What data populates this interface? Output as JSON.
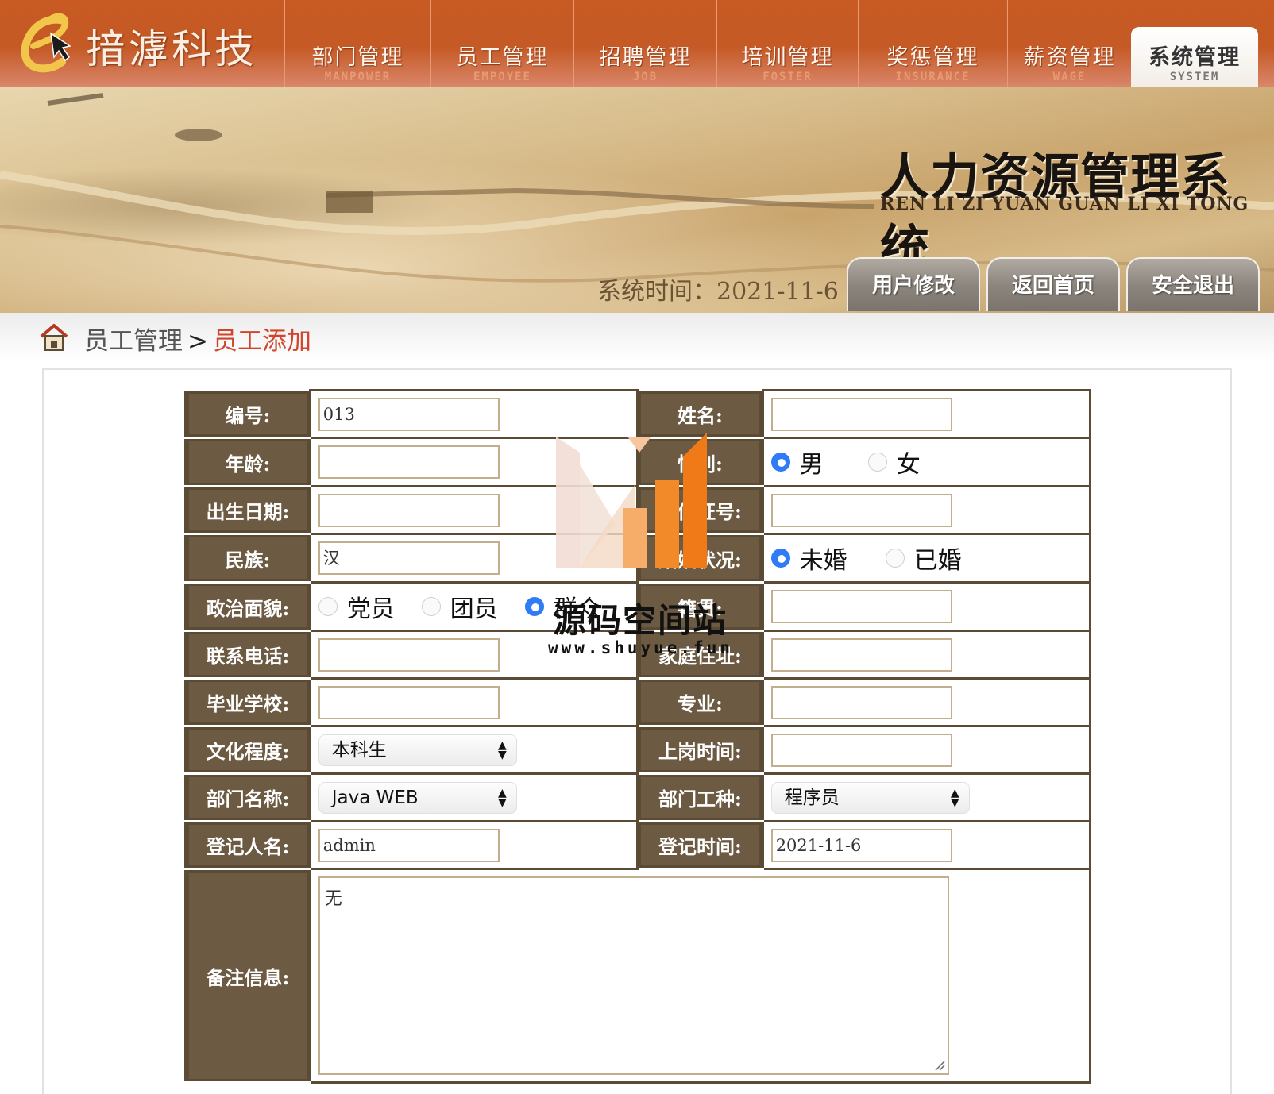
{
  "header": {
    "brand": "揞滹科技",
    "nav": [
      {
        "cn": "部门管理",
        "en": "MANPOWER"
      },
      {
        "cn": "员工管理",
        "en": "EMPOYEE"
      },
      {
        "cn": "招聘管理",
        "en": "JOB"
      },
      {
        "cn": "培训管理",
        "en": "FOSTER"
      },
      {
        "cn": "奖惩管理",
        "en": "INSURANCE"
      },
      {
        "cn": "薪资管理",
        "en": "WAGE"
      },
      {
        "cn": "系统管理",
        "en": "SYSTEM"
      }
    ],
    "active_nav": "系统管理"
  },
  "banner": {
    "title": "人力资源管理系统",
    "pinyin": "REN LI ZI YUAN GUAN LI XI TONG",
    "time_label": "系统时间：",
    "time_value": "2021-11-6",
    "buttons": {
      "edit_user": "用户修改",
      "home": "返回首页",
      "logout": "安全退出"
    }
  },
  "breadcrumb": {
    "parent": "员工管理",
    "separator": ">",
    "current": "员工添加"
  },
  "form": {
    "id_label": "编号:",
    "id_value": "013",
    "name_label": "姓名:",
    "name_value": "",
    "age_label": "年龄:",
    "age_value": "",
    "gender_label": "性别:",
    "gender_options": [
      "男",
      "女"
    ],
    "gender_selected": "男",
    "birth_label": "出生日期:",
    "birth_value": "",
    "idcard_label": "身份证号:",
    "idcard_value": "",
    "nation_label": "民族:",
    "nation_value": "汉",
    "marital_label": "婚姻状况:",
    "marital_options": [
      "未婚",
      "已婚"
    ],
    "marital_selected": "未婚",
    "political_label": "政治面貌:",
    "political_options": [
      "党员",
      "团员",
      "群众"
    ],
    "political_selected": "群众",
    "native_label": "籍贯:",
    "native_value": "",
    "phone_label": "联系电话:",
    "phone_value": "",
    "address_label": "家庭住址:",
    "address_value": "",
    "school_label": "毕业学校:",
    "school_value": "",
    "major_label": "专业:",
    "major_value": "",
    "education_label": "文化程度:",
    "education_value": "本科生",
    "onboard_label": "上岗时间:",
    "onboard_value": "",
    "dept_label": "部门名称:",
    "dept_value": "Java WEB",
    "job_label": "部门工种:",
    "job_value": "程序员",
    "registrar_label": "登记人名:",
    "registrar_value": "admin",
    "regtime_label": "登记时间:",
    "regtime_value": "2021-11-6",
    "remark_label": "备注信息:",
    "remark_value": "无"
  },
  "watermark": {
    "text": "源码空间站",
    "url": "www.shuyue.fun"
  },
  "colors": {
    "nav_bg": "#c85a22",
    "label_bg": "#6c5a42",
    "accent_red": "#d0452c",
    "radio_on": "#2f7cf6"
  }
}
